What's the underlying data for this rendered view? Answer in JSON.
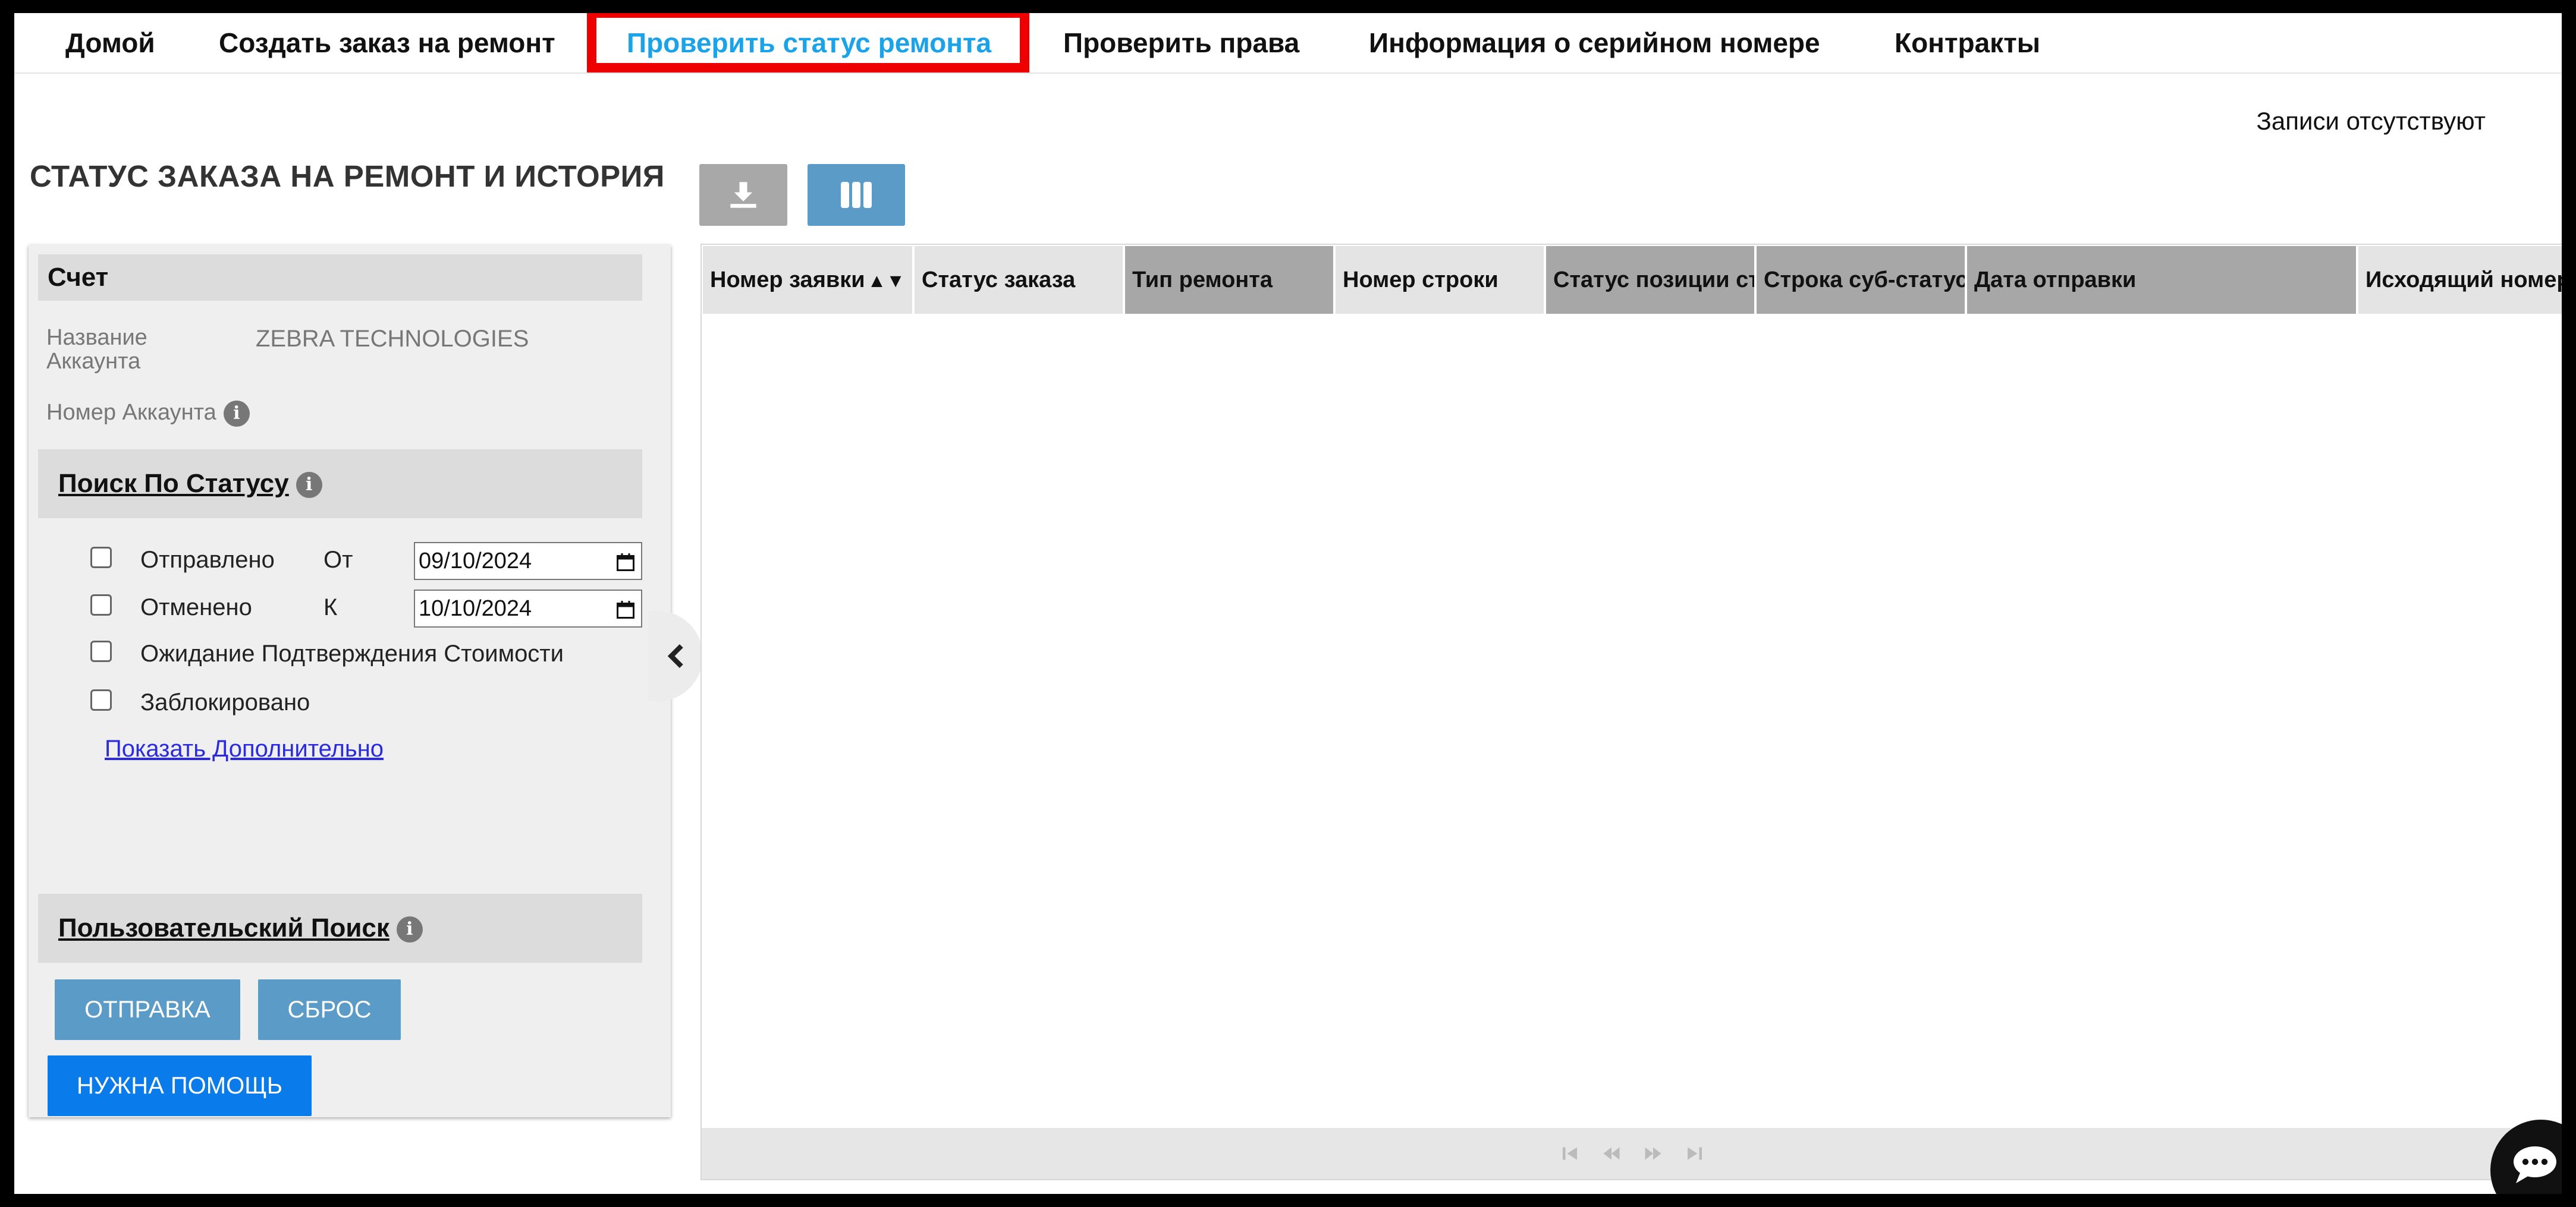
{
  "nav": {
    "items": [
      {
        "label": "Домой"
      },
      {
        "label": "Создать заказ на ремонт"
      },
      {
        "label": "Проверить статус ремонта"
      },
      {
        "label": "Проверить права"
      },
      {
        "label": "Информация о серийном номере"
      },
      {
        "label": "Контракты"
      }
    ],
    "active_index": 2,
    "active_color": "#1aa3e8",
    "highlight_color": "#ee0000"
  },
  "records_note": "Записи отсутствуют",
  "page_title": "СТАТУС ЗАКАЗА НА РЕМОНТ И ИСТОРИЯ",
  "toolbar": {
    "download_icon": "download-icon",
    "columns_icon": "columns-icon"
  },
  "account": {
    "header": "Счет",
    "name_label": "Название Аккаунта",
    "name_value": "ZEBRA TECHNOLOGIES",
    "number_label": "Номер Аккаунта"
  },
  "status_search": {
    "title": "Поиск По Статусу",
    "checkboxes": [
      {
        "label": "Отправлено",
        "checked": false
      },
      {
        "label": "Отменено",
        "checked": false
      },
      {
        "label": "Ожидание Подтверждения Стоимости",
        "checked": false
      },
      {
        "label": "Заблокировано",
        "checked": false
      }
    ],
    "from_label": "От",
    "from_value": "09/10/2024",
    "to_label": "К",
    "to_value": "10/10/2024",
    "show_more": "Показать Дополнительно"
  },
  "custom_search": {
    "title": "Пользовательский Поиск"
  },
  "buttons": {
    "submit": "ОТПРАВКА",
    "reset": "СБРОС",
    "help": "НУЖНА ПОМОЩЬ"
  },
  "grid": {
    "columns": [
      {
        "label": "Номер заявки"
      },
      {
        "label": "Статус заказа"
      },
      {
        "label": "Тип ремонта"
      },
      {
        "label": "Номер строки"
      },
      {
        "label": "Статус позиции строки"
      },
      {
        "label": "Строка суб-статуса"
      },
      {
        "label": "Дата отправки"
      },
      {
        "label": "Исходящий номер"
      }
    ],
    "sort_indicator": "▲▼",
    "rows": []
  },
  "chat": {
    "icon": "chat-icon"
  }
}
